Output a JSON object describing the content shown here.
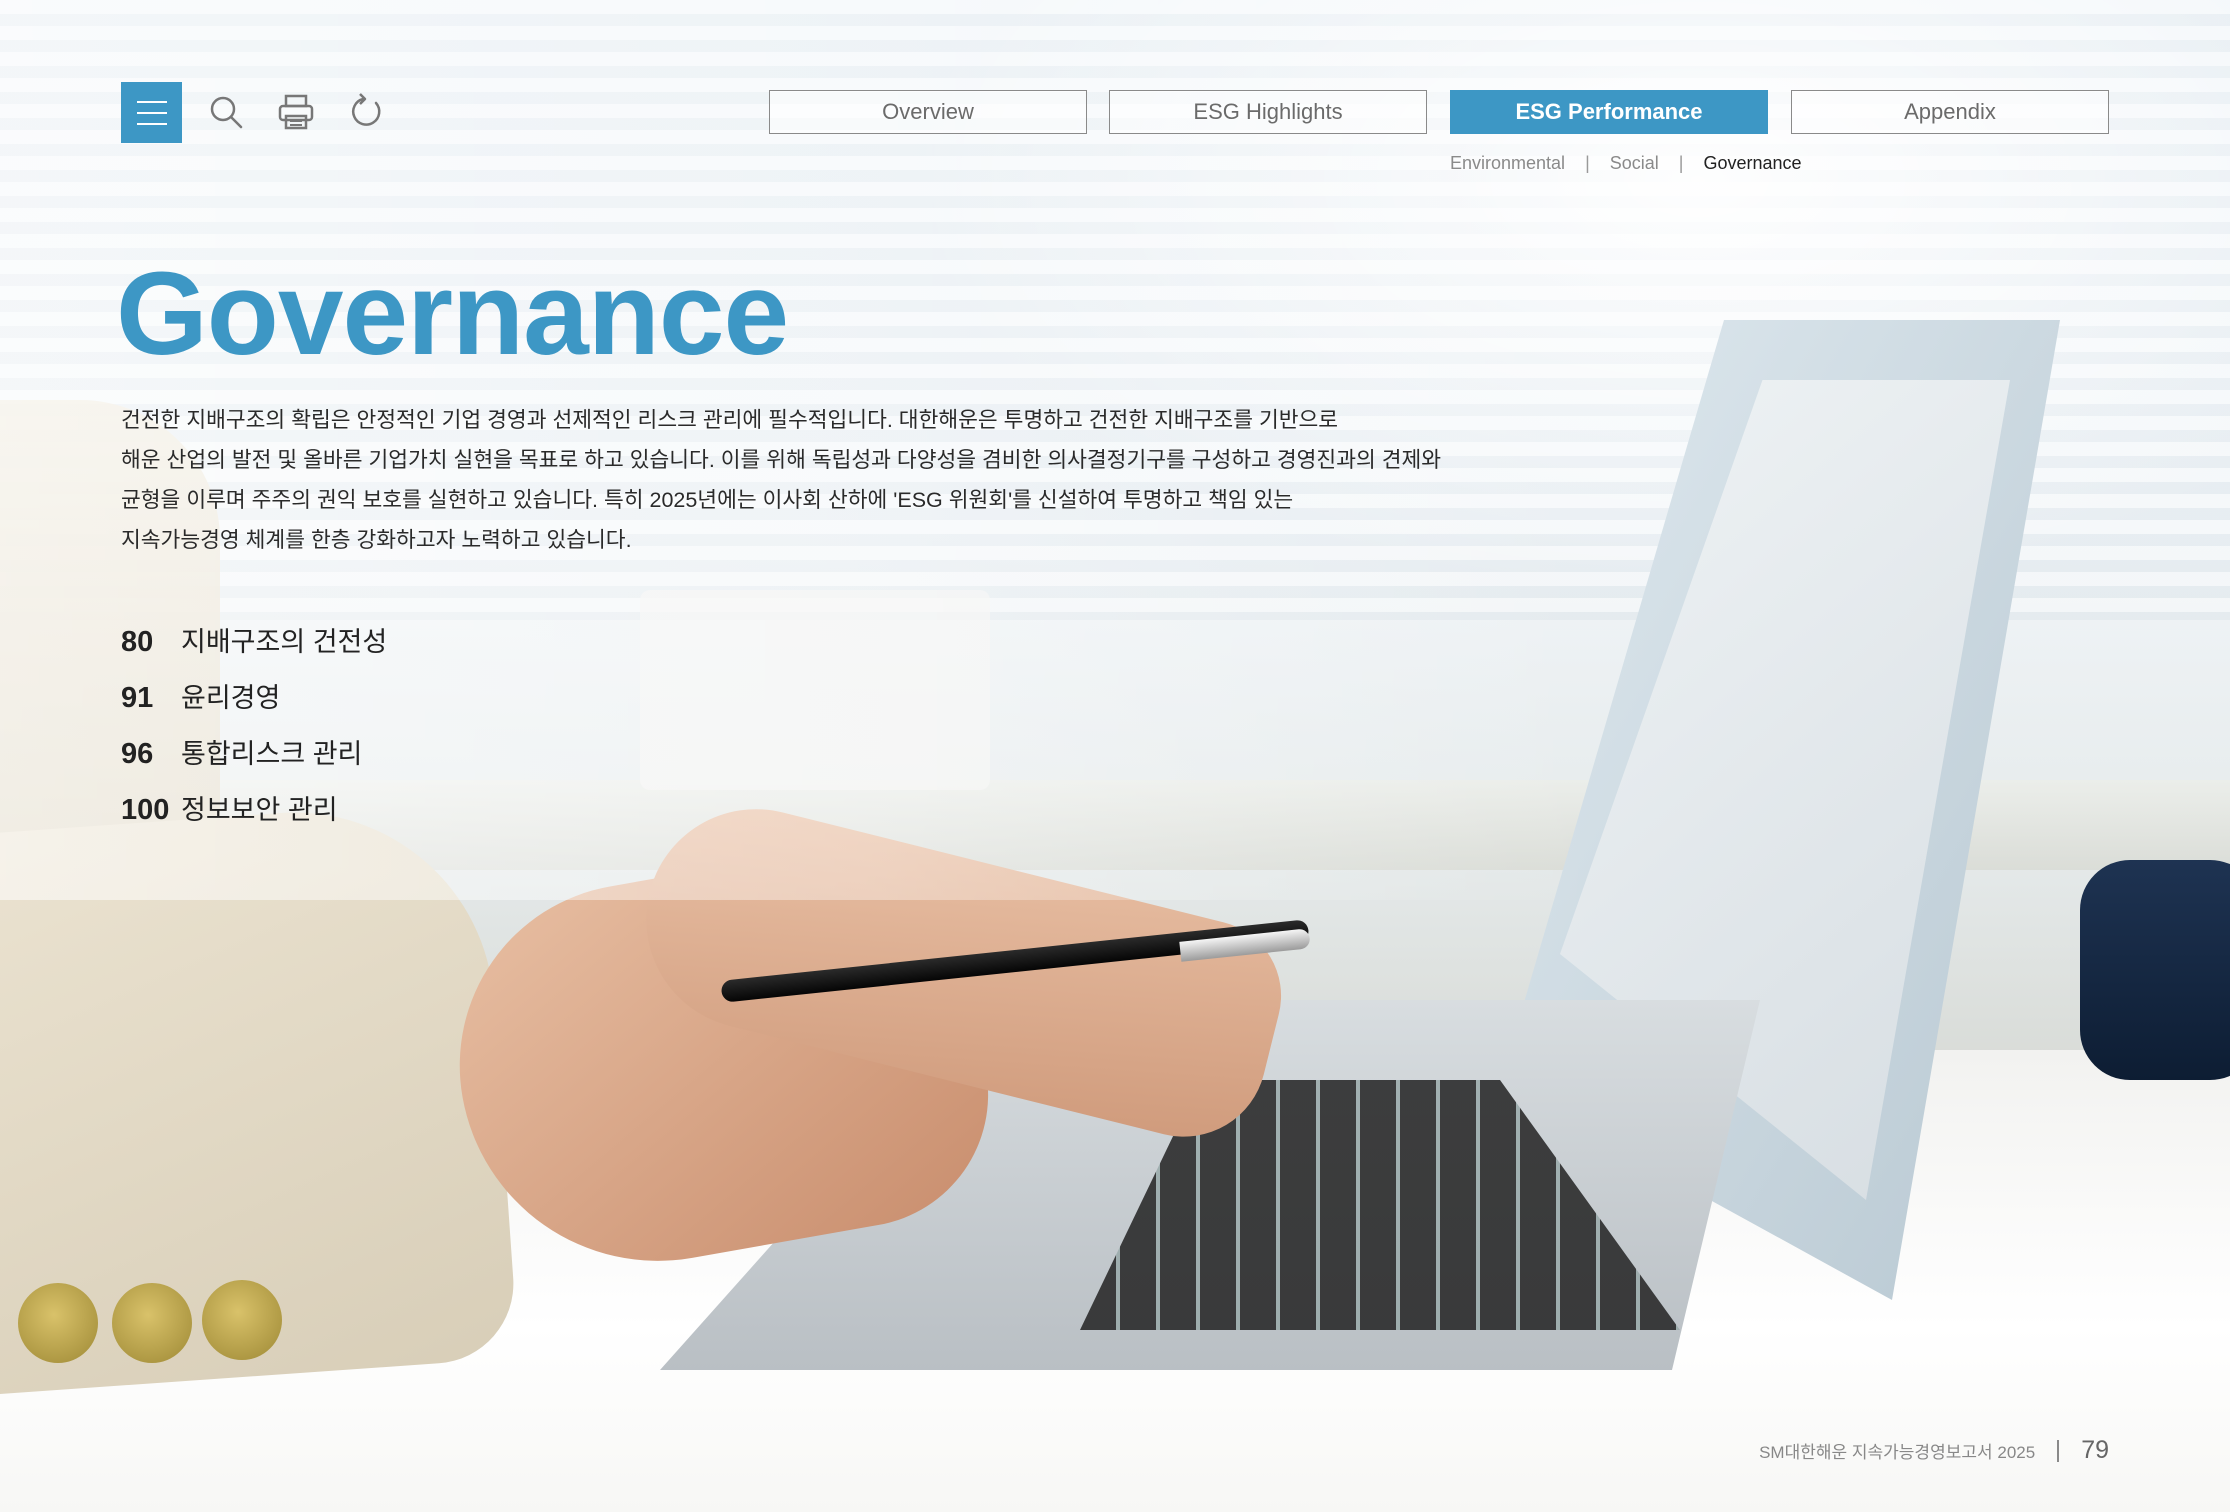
{
  "toolbar": {
    "icons": [
      "menu-icon",
      "search-icon",
      "print-icon",
      "refresh-icon"
    ]
  },
  "tabs": [
    {
      "label": "Overview",
      "active": false
    },
    {
      "label": "ESG Highlights",
      "active": false
    },
    {
      "label": "ESG Performance",
      "active": true
    },
    {
      "label": "Appendix",
      "active": false
    }
  ],
  "subnav": {
    "items": [
      "Environmental",
      "Social",
      "Governance"
    ],
    "current": "Governance",
    "separator": "|"
  },
  "title": "Governance",
  "intro_lines": [
    "건전한 지배구조의 확립은 안정적인 기업 경영과 선제적인 리스크 관리에 필수적입니다. 대한해운은 투명하고 건전한 지배구조를 기반으로",
    "해운 산업의 발전 및 올바른 기업가치 실현을 목표로 하고 있습니다. 이를 위해 독립성과 다양성을 겸비한 의사결정기구를 구성하고 경영진과의 견제와",
    "균형을 이루며 주주의 권익 보호를 실현하고 있습니다. 특히 2025년에는 이사회 산하에 'ESG 위원회'를 신설하여 투명하고 책임 있는",
    "지속가능경영 체계를 한층 강화하고자 노력하고 있습니다."
  ],
  "toc": [
    {
      "page": "80",
      "label": "지배구조의 건전성"
    },
    {
      "page": "91",
      "label": "윤리경영"
    },
    {
      "page": "96",
      "label": "통합리스크 관리"
    },
    {
      "page": "100",
      "label": "정보보안 관리"
    }
  ],
  "footer": {
    "report": "SM대한해운 지속가능경영보고서 2025",
    "separator": "|",
    "page_number": "79"
  },
  "colors": {
    "accent": "#3d97c5",
    "text": "#2a2a2a",
    "muted": "#8a8a8a"
  }
}
